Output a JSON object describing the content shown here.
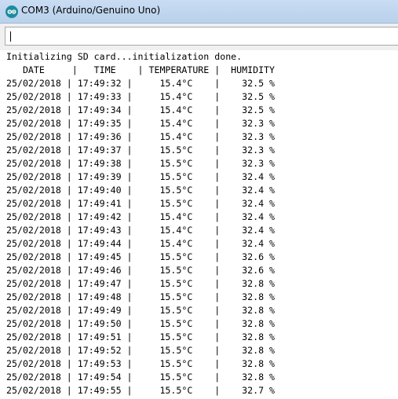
{
  "window": {
    "title": "COM3 (Arduino/Genuino Uno)",
    "icon": "arduino-icon",
    "accent_color": "#1c8c9c"
  },
  "send_input": {
    "value": ""
  },
  "serial_output": {
    "lines": [
      "Initializing SD card...initialization done.",
      "   DATE     |   TIME    | TEMPERATURE |  HUMIDITY",
      "25/02/2018 | 17:49:32 |     15.4°C    |    32.5 %",
      "25/02/2018 | 17:49:33 |     15.4°C    |    32.5 %",
      "25/02/2018 | 17:49:34 |     15.4°C    |    32.5 %",
      "25/02/2018 | 17:49:35 |     15.4°C    |    32.3 %",
      "25/02/2018 | 17:49:36 |     15.4°C    |    32.3 %",
      "25/02/2018 | 17:49:37 |     15.5°C    |    32.3 %",
      "25/02/2018 | 17:49:38 |     15.5°C    |    32.3 %",
      "25/02/2018 | 17:49:39 |     15.5°C    |    32.4 %",
      "25/02/2018 | 17:49:40 |     15.5°C    |    32.4 %",
      "25/02/2018 | 17:49:41 |     15.5°C    |    32.4 %",
      "25/02/2018 | 17:49:42 |     15.4°C    |    32.4 %",
      "25/02/2018 | 17:49:43 |     15.4°C    |    32.4 %",
      "25/02/2018 | 17:49:44 |     15.4°C    |    32.4 %",
      "25/02/2018 | 17:49:45 |     15.5°C    |    32.6 %",
      "25/02/2018 | 17:49:46 |     15.5°C    |    32.6 %",
      "25/02/2018 | 17:49:47 |     15.5°C    |    32.8 %",
      "25/02/2018 | 17:49:48 |     15.5°C    |    32.8 %",
      "25/02/2018 | 17:49:49 |     15.5°C    |    32.8 %",
      "25/02/2018 | 17:49:50 |     15.5°C    |    32.8 %",
      "25/02/2018 | 17:49:51 |     15.5°C    |    32.8 %",
      "25/02/2018 | 17:49:52 |     15.5°C    |    32.8 %",
      "25/02/2018 | 17:49:53 |     15.5°C    |    32.8 %",
      "25/02/2018 | 17:49:54 |     15.5°C    |    32.8 %",
      "25/02/2018 | 17:49:55 |     15.5°C    |    32.7 %"
    ]
  }
}
